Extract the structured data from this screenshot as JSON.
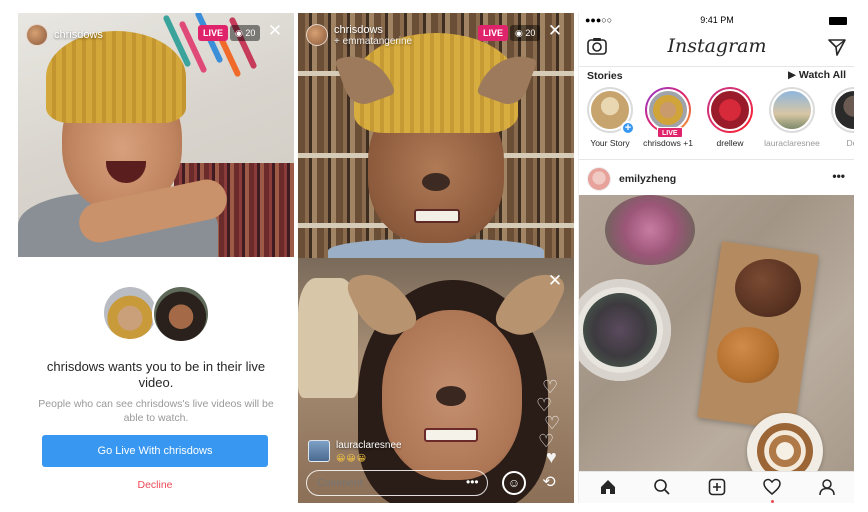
{
  "colors": {
    "live": "#e0246b",
    "primary_button": "#3897f0",
    "decline": "#ed4956"
  },
  "panel_invite": {
    "host_handle": "chrisdows",
    "live_label": "LIVE",
    "viewer_count": "20",
    "invite_title": "chrisdows wants you to be in their live video.",
    "invite_description": "People who can see chrisdows's live videos will be able to watch.",
    "go_live_button": "Go Live With chrisdows",
    "decline_button": "Decline"
  },
  "panel_live": {
    "host_handle": "chrisdows",
    "guest_line": "emmatangerine",
    "live_label": "LIVE",
    "viewer_count": "20",
    "comment_user": "lauraclaresnee",
    "comment_text": "😀😀😀",
    "comment_placeholder": "Comment",
    "more_label": "•••"
  },
  "panel_feed": {
    "status_time": "9:41 PM",
    "signal": "●●●○○",
    "app_title": "Instagram",
    "stories_label": "Stories",
    "watch_all_label": "▶ Watch All",
    "stories": [
      {
        "name": "Your Story",
        "icon": "add-story-icon"
      },
      {
        "name": "chrisdows +1",
        "live": "LIVE"
      },
      {
        "name": "drellew"
      },
      {
        "name": "lauraclaresnee"
      },
      {
        "name": "Deit"
      }
    ],
    "post_user": "emilyzheng",
    "post_more": "•••",
    "tabs": [
      "home-icon",
      "search-icon",
      "add-post-icon",
      "activity-heart-icon",
      "profile-icon"
    ]
  }
}
